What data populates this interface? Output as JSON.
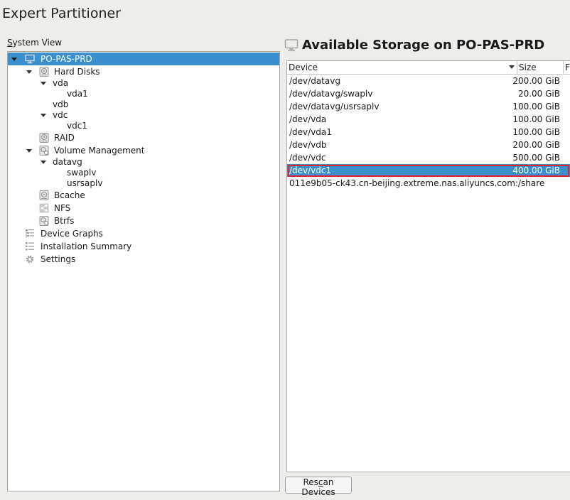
{
  "window": {
    "title": "Expert Partitioner"
  },
  "system_view": {
    "label_prefix": "",
    "label_accel": "S",
    "label_rest": "ystem View"
  },
  "tree": [
    {
      "label": "PO-PAS-PRD",
      "icon": "monitor-icon",
      "expanded": true,
      "selected": true
    },
    {
      "label": "Hard Disks",
      "icon": "hard-disk-icon",
      "expanded": true
    },
    {
      "label": "vda",
      "expanded": true
    },
    {
      "label": "vda1"
    },
    {
      "label": "vdb"
    },
    {
      "label": "vdc",
      "expanded": true
    },
    {
      "label": "vdc1"
    },
    {
      "label": "RAID",
      "icon": "raid-icon"
    },
    {
      "label": "Volume Management",
      "icon": "volume-management-icon",
      "expanded": true
    },
    {
      "label": "datavg",
      "expanded": true
    },
    {
      "label": "swaplv"
    },
    {
      "label": "usrsaplv"
    },
    {
      "label": "Bcache",
      "icon": "bcache-icon"
    },
    {
      "label": "NFS",
      "icon": "nfs-share-icon"
    },
    {
      "label": "Btrfs",
      "icon": "btrfs-icon"
    },
    {
      "label": "Device Graphs",
      "icon": "device-graphs-icon"
    },
    {
      "label": "Installation Summary",
      "icon": "installation-summary-icon"
    },
    {
      "label": "Settings",
      "icon": "gear-icon"
    }
  ],
  "storage": {
    "title": "Available Storage on PO-PAS-PRD",
    "columns": {
      "device": "Device",
      "size": "Size",
      "third": "F"
    },
    "rows": [
      {
        "device": "/dev/datavg",
        "size": "200.00 GiB"
      },
      {
        "device": "/dev/datavg/swaplv",
        "size": "20.00 GiB"
      },
      {
        "device": "/dev/datavg/usrsaplv",
        "size": "100.00 GiB"
      },
      {
        "device": "/dev/vda",
        "size": "100.00 GiB"
      },
      {
        "device": "/dev/vda1",
        "size": "100.00 GiB"
      },
      {
        "device": "/dev/vdb",
        "size": "200.00 GiB"
      },
      {
        "device": "/dev/vdc",
        "size": "500.00 GiB"
      },
      {
        "device": "/dev/vdc1",
        "size": "400.00 GiB",
        "selected": true
      },
      {
        "device": "011e9b05-ck43.cn-beijing.extreme.nas.aliyuncs.com:/share",
        "size": ""
      }
    ]
  },
  "buttons": {
    "rescan_pre": "Res",
    "rescan_accel": "c",
    "rescan_post": "an Devices"
  },
  "colors": {
    "selection": "#3c8fcf",
    "highlight_border": "#e0262c",
    "background": "#efedea"
  }
}
